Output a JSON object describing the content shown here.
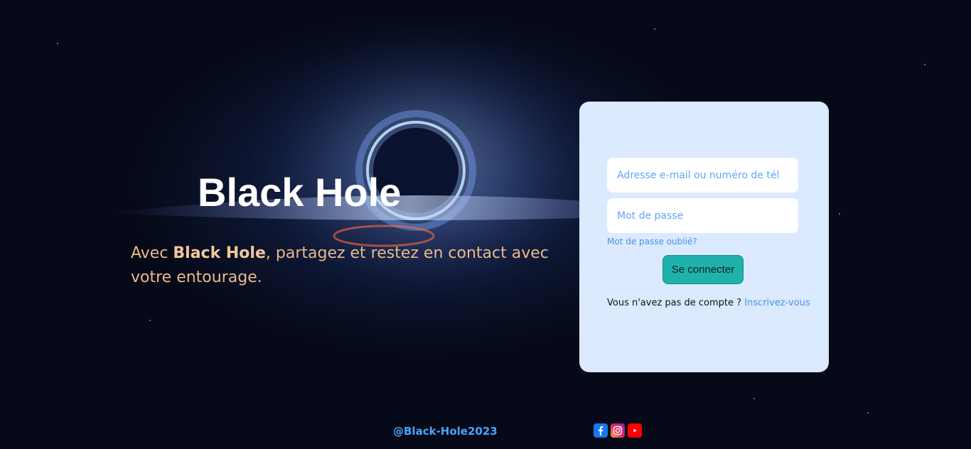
{
  "hero": {
    "title": "Black Hole",
    "tagline_prefix": "Avec ",
    "tagline_brand": "Black Hole",
    "tagline_suffix": ", partagez et restez en contact avec votre entourage."
  },
  "login": {
    "email_placeholder": "Adresse e-mail ou numéro de tél",
    "password_placeholder": "Mot de passe",
    "forgot_label": "Mot de passe oublié?",
    "submit_label": "Se connecter",
    "signup_prompt": "Vous n'avez pas de compte ? ",
    "signup_link": "Inscrivez-vous"
  },
  "footer": {
    "handle": "@Black-Hole2023",
    "socials": [
      "facebook-icon",
      "instagram-icon",
      "youtube-icon"
    ]
  },
  "colors": {
    "card_bg": "#dbeafe",
    "button_bg": "#20b2aa",
    "link": "#4a90e2",
    "tagline": "#e9b98a"
  }
}
